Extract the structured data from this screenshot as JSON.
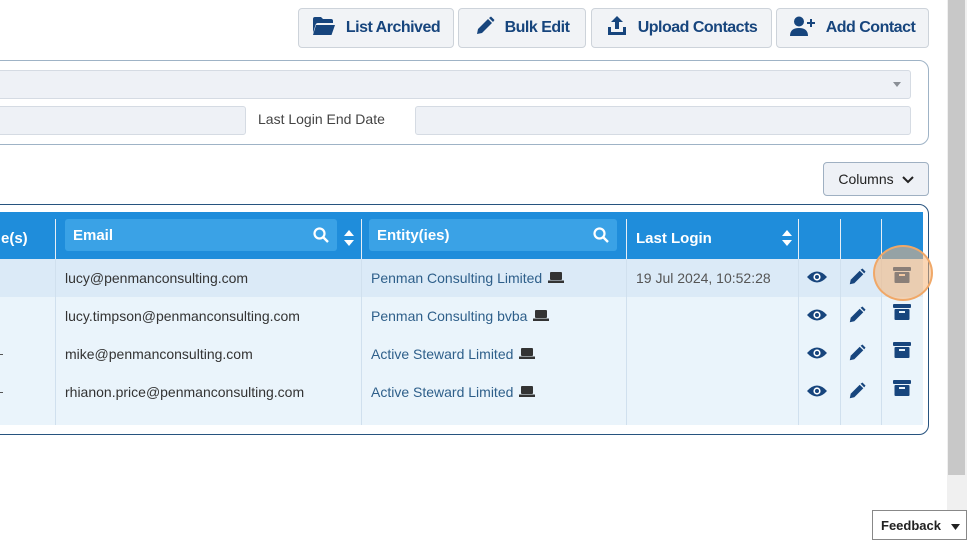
{
  "toolbar": {
    "list_archived": "List Archived",
    "bulk_edit": "Bulk Edit",
    "upload_contacts": "Upload Contacts",
    "add_contact": "Add Contact"
  },
  "filters": {
    "last_login_end_label": "Last Login End Date"
  },
  "columns_button": "Columns",
  "table": {
    "headers": {
      "roles_partial": "e(s)",
      "email": "Email",
      "entities": "Entity(ies)",
      "last_login": "Last Login"
    },
    "rows": [
      {
        "email": "lucy@penmanconsulting.com",
        "entity": "Penman Consulting Limited",
        "last_login": "19 Jul 2024, 10:52:28"
      },
      {
        "email": "lucy.timpson@penmanconsulting.com",
        "entity": "Penman Consulting bvba",
        "last_login": ""
      },
      {
        "email": "mike@penmanconsulting.com",
        "entity": "Active Steward Limited",
        "last_login": ""
      },
      {
        "email": "rhianon.price@penmanconsulting.com",
        "entity": "Active Steward Limited",
        "last_login": ""
      }
    ]
  },
  "feedback": "Feedback",
  "icons": {
    "list_archived": "folder-open-icon",
    "bulk_edit": "pencil-icon",
    "upload": "upload-icon",
    "add_contact": "user-plus-icon",
    "view": "eye-icon",
    "edit": "pencil-icon",
    "archive": "archive-icon",
    "laptop": "laptop-icon",
    "search": "search-icon",
    "sort": "sort-icon"
  },
  "colors": {
    "header_bg": "#1f8ddb",
    "button_text": "#17457d",
    "row_even": "#dbeaf7",
    "row_odd": "#eaf4fb",
    "highlight": "#f0a868"
  }
}
